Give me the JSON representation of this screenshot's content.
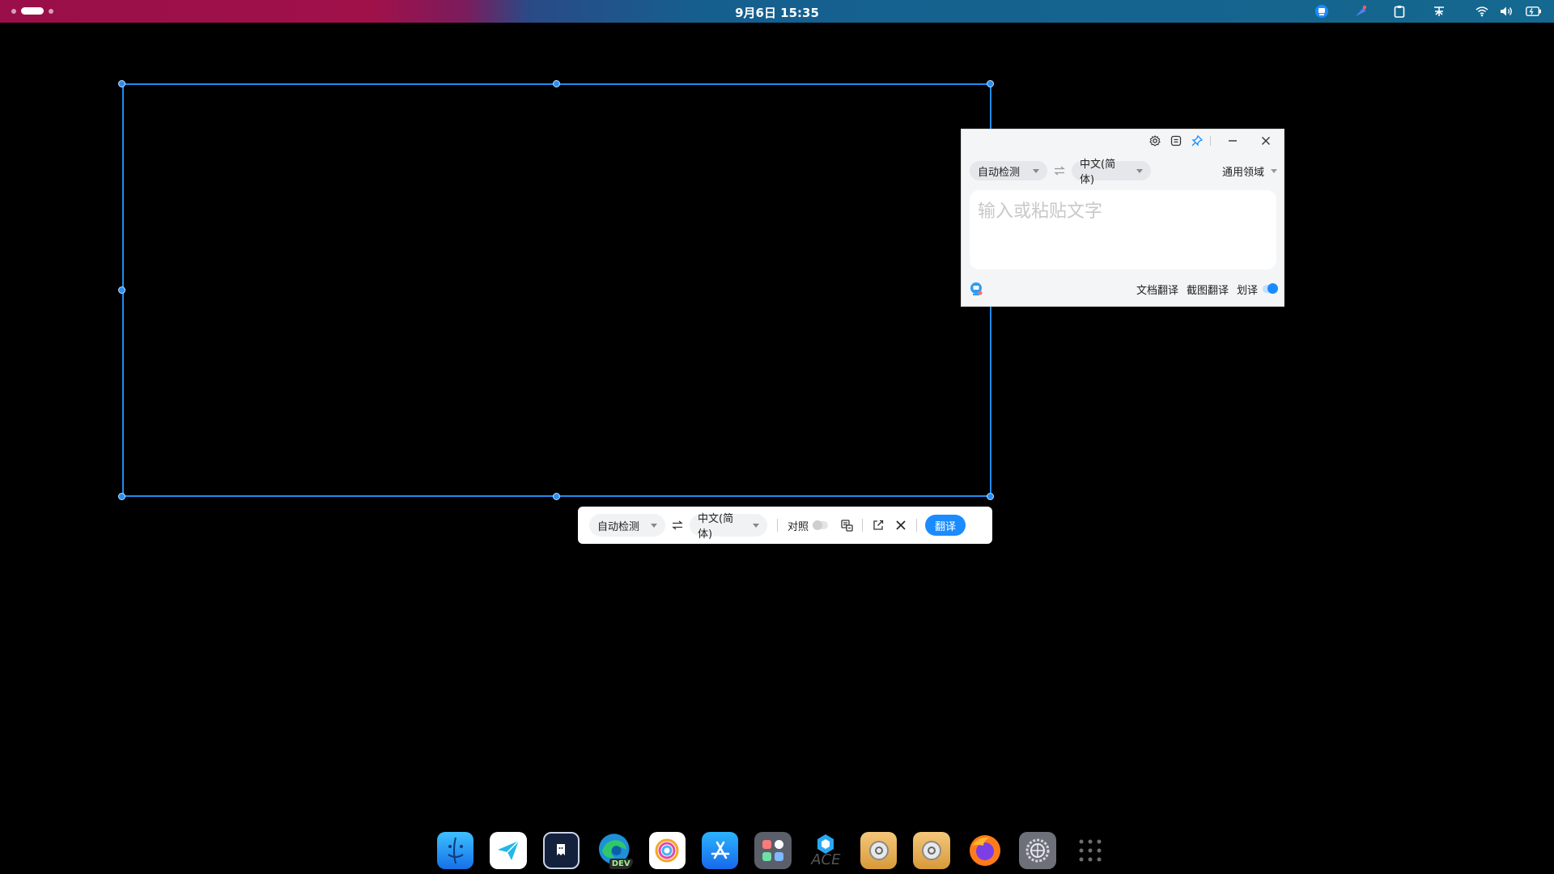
{
  "topbar": {
    "clock": "9月6日  15:35",
    "tray_icons": [
      "translator-tray-icon",
      "feather-tray-icon",
      "clipboard-icon",
      "input-method-icon",
      "wifi-icon",
      "volume-icon",
      "battery-icon"
    ],
    "accent": "#9a0f49"
  },
  "capture": {
    "source_lang": "自动检测",
    "target_lang": "中文(简体)",
    "compare_label": "对照",
    "compare_enabled": false,
    "translate_button": "翻译",
    "icons": [
      "swap-icon",
      "image-text-icon",
      "export-icon",
      "close-icon"
    ]
  },
  "translator": {
    "source_lang": "自动检测",
    "target_lang": "中文(简体)",
    "domain": "通用领域",
    "input_placeholder": "输入或粘贴文字",
    "input_value": "",
    "doc_translate": "文档翻译",
    "screenshot_translate": "截图翻译",
    "word_translate": "划译",
    "word_translate_enabled": true,
    "title_icons": [
      "settings-icon",
      "screenshot-icon",
      "pin-icon",
      "minimize-icon",
      "close-icon"
    ]
  },
  "dock": {
    "apps": [
      "finder",
      "paper-plane",
      "terminal",
      "edge-dev",
      "pinwheel",
      "app-store",
      "launchpad",
      "ace",
      "settings-gold",
      "settings-gold-2",
      "firefox",
      "system-settings",
      "app-grid"
    ],
    "dev_badge": "DEV",
    "ace_label": "ACE"
  },
  "colors": {
    "selection": "#1f8cf0",
    "primary": "#1a8cff"
  }
}
